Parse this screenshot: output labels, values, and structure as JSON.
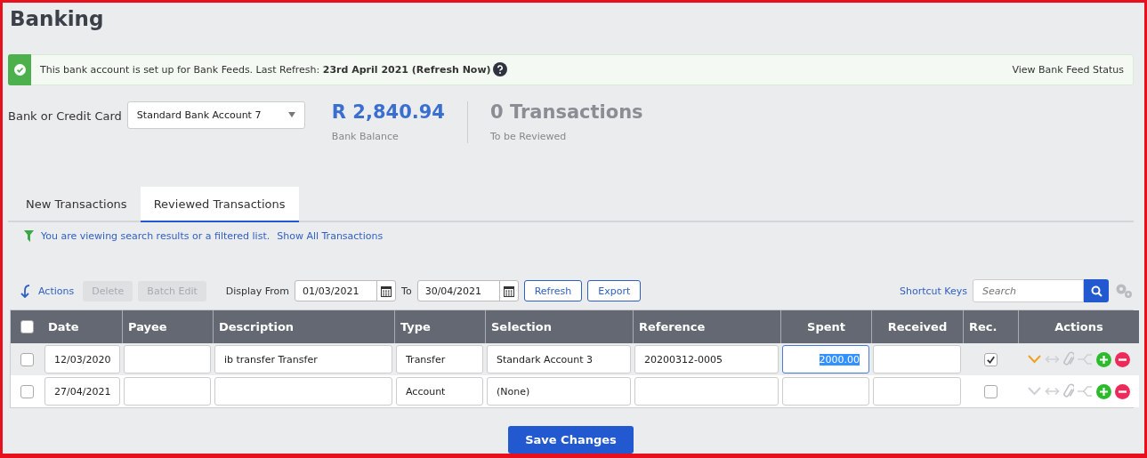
{
  "page_title": "Banking",
  "banner": {
    "message": "This bank account is set up for Bank Feeds. Last Refresh: **23rd April 2021 (Refresh Now)**",
    "link": "View Bank Feed Status"
  },
  "bank_select": {
    "label": "Bank or Credit Card",
    "value": "Standard Bank Account 7"
  },
  "stats": [
    {
      "value": "R 2,840.94",
      "caption": "Bank Balance",
      "kind": "balance"
    },
    {
      "value": "0 Transactions",
      "caption": "To be Reviewed",
      "kind": "count"
    }
  ],
  "tabs": [
    {
      "label": "New Transactions",
      "selected": false
    },
    {
      "label": "Reviewed Transactions",
      "selected": true
    }
  ],
  "filter_notice": {
    "message": "You are viewing search results or a filtered list.",
    "link": "Show All Transactions"
  },
  "toolbar": {
    "actions": "Actions",
    "buttons": [
      {
        "label": "Delete",
        "disabled": true
      },
      {
        "label": "Batch Edit",
        "disabled": true
      }
    ],
    "display_from_label": "Display From",
    "from": "01/03/2021",
    "to_label": "To",
    "to": "30/04/2021",
    "refresh": "Refresh",
    "export": "Export",
    "shortcut_keys": "Shortcut Keys",
    "search_placeholder": "Search"
  },
  "table": {
    "select_all_checked": false,
    "columns": [
      "Date",
      "Payee",
      "Description",
      "Type",
      "Selection",
      "Reference",
      "Spent",
      "Received",
      "Rec.",
      "Actions"
    ],
    "rows": [
      {
        "selected": true,
        "checked": false,
        "date": "12/03/2020",
        "payee": "",
        "description": "ib transfer Transfer",
        "type": "Transfer",
        "selection": "Standark Account 3",
        "reference": "20200312-0005",
        "spent": "2000.00",
        "spent_focused": true,
        "received": "",
        "reconciled": true
      },
      {
        "selected": false,
        "checked": false,
        "date": "27/04/2021",
        "payee": "",
        "description": "",
        "type": "Account",
        "selection": "(None)",
        "reference": "",
        "spent": "",
        "spent_focused": false,
        "received": "",
        "reconciled": false
      }
    ]
  },
  "save_button": "Save Changes"
}
